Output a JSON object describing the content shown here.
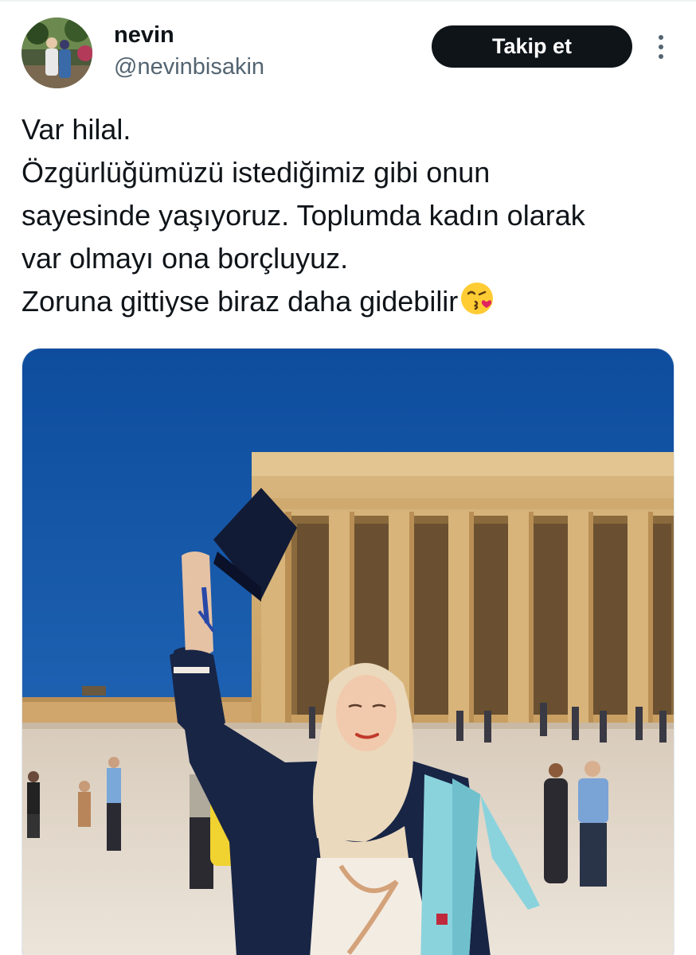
{
  "user": {
    "display_name": "nevin",
    "handle": "@nevinbisakin",
    "avatar_icon": "profile-photo"
  },
  "actions": {
    "follow_label": "Takip et",
    "more_icon": "more-vertical-icon"
  },
  "tweet": {
    "lines": [
      "Var hilal.",
      "Özgürlüğümüzü istediğimiz gibi onun",
      "sayesinde yaşıyoruz. Toplumda kadın olarak",
      "var olmayı ona borçluyuz.",
      "Zoruna gittiyse biraz daha gidebilir"
    ],
    "trailing_emoji": "kiss-emoji"
  },
  "media": {
    "subject": "graduation-photo"
  },
  "colors": {
    "text": "#0f1419",
    "secondary": "#536471",
    "button_bg": "#0f1419",
    "button_text": "#ffffff"
  }
}
